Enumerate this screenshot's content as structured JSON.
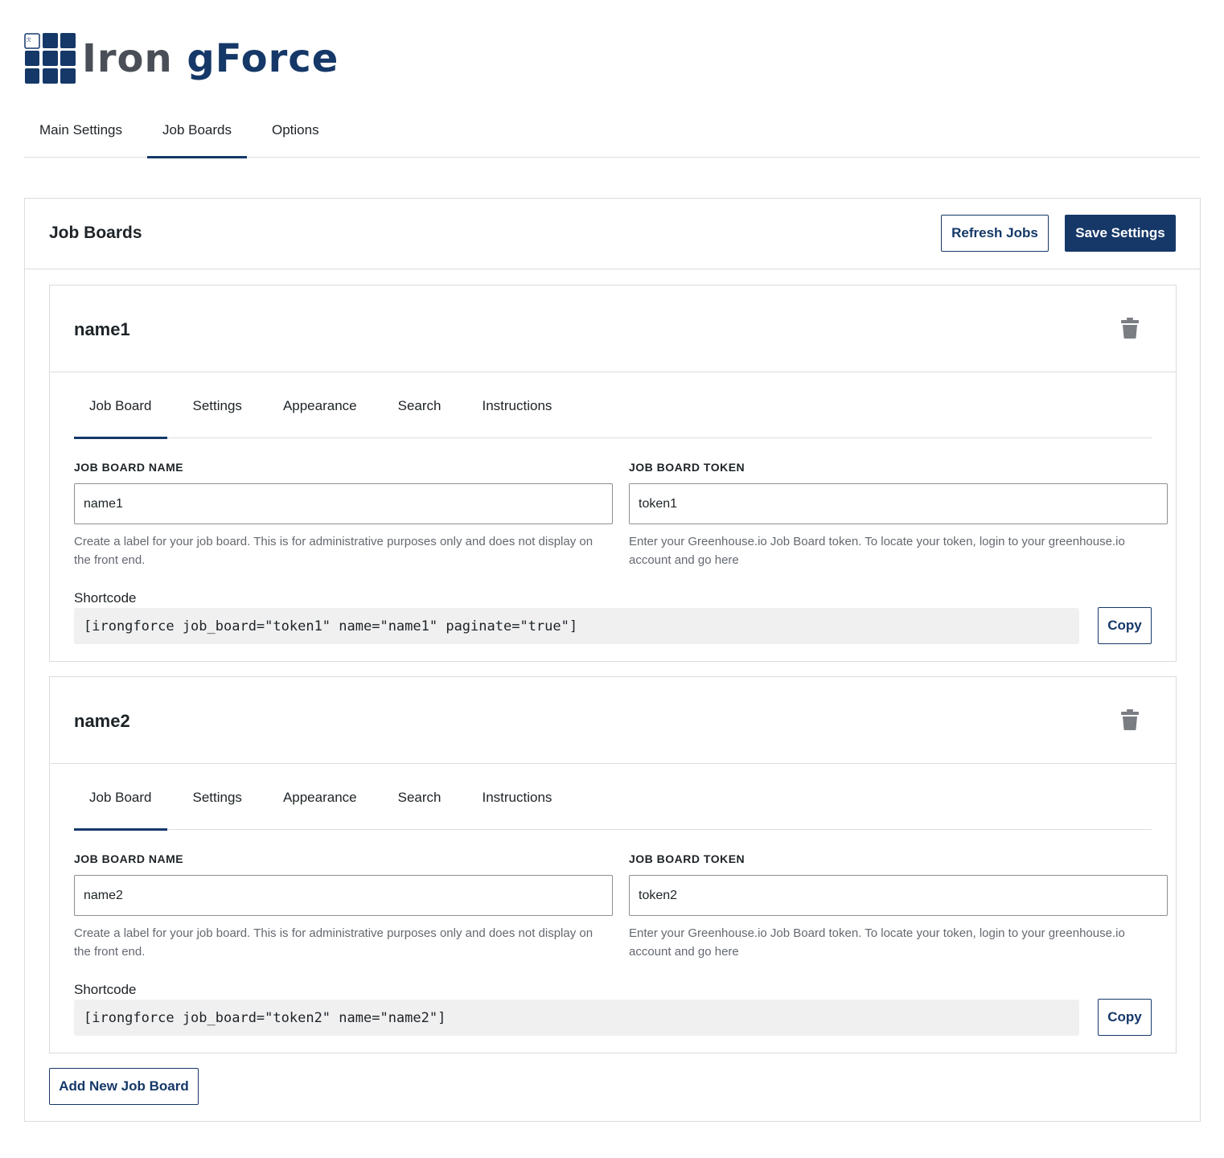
{
  "brand": {
    "word1": "Iron",
    "word2": "gForce",
    "color_primary": "#153868",
    "color_secondary": "#4a4f57"
  },
  "top_tabs": [
    {
      "label": "Main Settings",
      "active": false
    },
    {
      "label": "Job Boards",
      "active": true
    },
    {
      "label": "Options",
      "active": false
    }
  ],
  "panel": {
    "title": "Job Boards",
    "refresh_label": "Refresh Jobs",
    "save_label": "Save Settings",
    "add_label": "Add New Job Board"
  },
  "field_labels": {
    "name": "JOB BOARD NAME",
    "token": "JOB BOARD TOKEN",
    "shortcode": "Shortcode",
    "copy": "Copy"
  },
  "help": {
    "name": "Create a label for your job board. This is for administrative purposes only and does not display on the front end.",
    "token": "Enter your Greenhouse.io Job Board token. To locate your token, login to your greenhouse.io account and go here"
  },
  "boards": [
    {
      "title": "name1",
      "tabs": [
        "Job Board",
        "Settings",
        "Appearance",
        "Search",
        "Instructions"
      ],
      "active_tab": "Job Board",
      "name_value": "name1",
      "token_value": "token1",
      "shortcode": "[irongforce job_board=\"token1\" name=\"name1\" paginate=\"true\"]"
    },
    {
      "title": "name2",
      "tabs": [
        "Job Board",
        "Settings",
        "Appearance",
        "Search",
        "Instructions"
      ],
      "active_tab": "Job Board",
      "name_value": "name2",
      "token_value": "token2",
      "shortcode": "[irongforce job_board=\"token2\" name=\"name2\"]"
    }
  ],
  "icons": {
    "logo": "grid-logo-icon",
    "delete": "trash-icon"
  }
}
